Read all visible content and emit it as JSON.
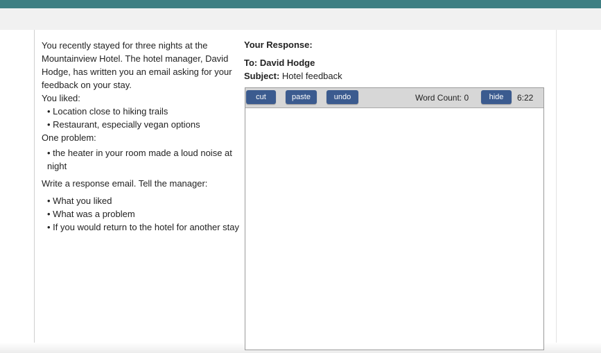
{
  "prompt": {
    "intro": "You recently stayed for three nights at the Mountainview Hotel.  The hotel manager, David Hodge, has written you an email asking for your feedback on your stay.",
    "liked_heading": "You liked:",
    "liked_items": [
      "Location close to hiking trails",
      "Restaurant, especially vegan options"
    ],
    "problem_heading": "One problem:",
    "problem_items": [
      "the heater in your room made a loud noise at night"
    ],
    "task_heading": "Write a response email.  Tell the manager:",
    "task_items": [
      "What you liked",
      "What was a problem",
      "If you would return to the hotel for another stay"
    ]
  },
  "response": {
    "heading": "Your Response:",
    "to_label": "To:",
    "to_value": "David Hodge",
    "subject_label": "Subject:",
    "subject_value": "Hotel  feedback"
  },
  "toolbar": {
    "cut_label": "cut",
    "paste_label": "paste",
    "undo_label": "undo",
    "word_count_label": "Word Count:",
    "word_count_value": "0",
    "hide_label": "hide",
    "timer": "6:22"
  },
  "editor": {
    "value": ""
  },
  "colors": {
    "top_bar": "#3f7f83",
    "button": "#3b5b8f",
    "toolbar": "#d7d7d7"
  }
}
